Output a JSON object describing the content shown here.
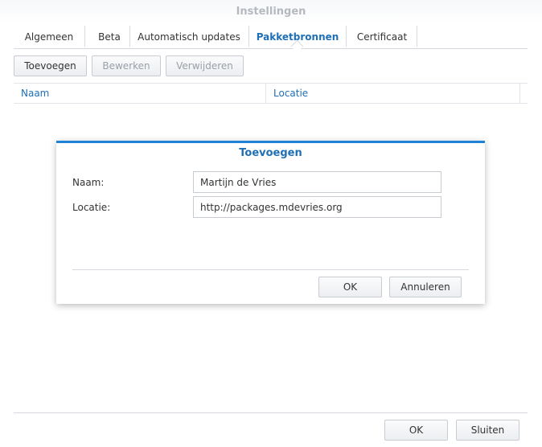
{
  "window": {
    "title": "Instellingen"
  },
  "tabs": [
    {
      "label": "Algemeen"
    },
    {
      "label": "Beta"
    },
    {
      "label": "Automatisch updates"
    },
    {
      "label": "Pakketbronnen",
      "active": true
    },
    {
      "label": "Certificaat"
    }
  ],
  "toolbar": {
    "add_label": "Toevoegen",
    "edit_label": "Bewerken",
    "delete_label": "Verwijderen"
  },
  "grid": {
    "columns": [
      {
        "label": "Naam"
      },
      {
        "label": "Locatie"
      }
    ]
  },
  "dialog": {
    "title": "Toevoegen",
    "name_label": "Naam:",
    "name_value": "Martijn de Vries",
    "location_label": "Locatie:",
    "location_value": "http://packages.mdevries.org",
    "ok_label": "OK",
    "cancel_label": "Annuleren"
  },
  "footer": {
    "ok_label": "OK",
    "close_label": "Sluiten"
  },
  "colors": {
    "accent": "#1f6fb5",
    "dialog_border": "#1f82d4"
  }
}
